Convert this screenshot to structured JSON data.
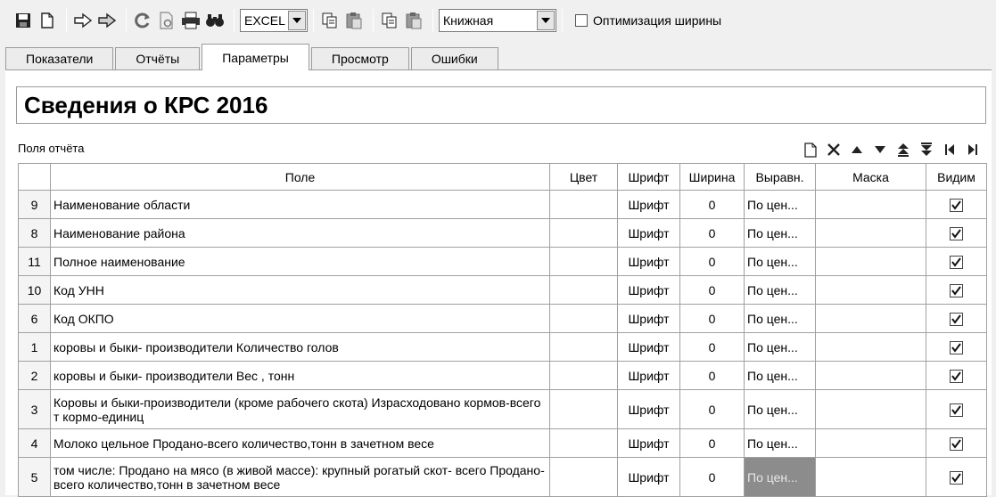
{
  "toolbar": {
    "export_format": "EXCEL",
    "orientation": "Книжная",
    "optimize_width_label": "Оптимизация ширины",
    "optimize_width_checked": false,
    "icons": [
      "save-icon",
      "new-document-icon",
      "export-icon",
      "import-icon",
      "refresh-icon",
      "preview-icon",
      "print-icon",
      "find-icon",
      "copy-icon",
      "paste-icon",
      "copy2-icon",
      "paste2-icon"
    ]
  },
  "tabs": [
    {
      "label": "Показатели",
      "active": false
    },
    {
      "label": "Отчёты",
      "active": false
    },
    {
      "label": "Параметры",
      "active": true
    },
    {
      "label": "Просмотр",
      "active": false
    },
    {
      "label": "Ошибки",
      "active": false
    }
  ],
  "report": {
    "title": "Сведения о КРС 2016",
    "fields_label": "Поля отчёта"
  },
  "grid": {
    "columns": [
      "Поле",
      "Цвет",
      "Шрифт",
      "Ширина",
      "Выравн.",
      "Маска",
      "Видим"
    ],
    "rows": [
      {
        "num": "9",
        "field": "Наименование области",
        "color": "",
        "font": "Шрифт",
        "width": "0",
        "align": "По цен...",
        "mask": "",
        "visible": true
      },
      {
        "num": "8",
        "field": "Наименование района",
        "color": "",
        "font": "Шрифт",
        "width": "0",
        "align": "По цен...",
        "mask": "",
        "visible": true
      },
      {
        "num": "11",
        "field": "Полное наименование",
        "color": "",
        "font": "Шрифт",
        "width": "0",
        "align": "По цен...",
        "mask": "",
        "visible": true
      },
      {
        "num": "10",
        "field": "Код УНН",
        "color": "",
        "font": "Шрифт",
        "width": "0",
        "align": "По цен...",
        "mask": "",
        "visible": true
      },
      {
        "num": "6",
        "field": "Код ОКПО",
        "color": "",
        "font": "Шрифт",
        "width": "0",
        "align": "По цен...",
        "mask": "",
        "visible": true
      },
      {
        "num": "1",
        "field": "коровы и быки- производители Количество голов",
        "color": "",
        "font": "Шрифт",
        "width": "0",
        "align": "По цен...",
        "mask": "",
        "visible": true
      },
      {
        "num": "2",
        "field": "коровы и быки- производители Вес , тонн",
        "color": "",
        "font": "Шрифт",
        "width": "0",
        "align": "По цен...",
        "mask": "",
        "visible": true
      },
      {
        "num": "3",
        "field": "Коровы и быки-производители (кроме рабочего скота) Израсходовано кормов-всего  т кормо-единиц",
        "color": "",
        "font": "Шрифт",
        "width": "0",
        "align": "По цен...",
        "mask": "",
        "visible": true
      },
      {
        "num": "4",
        "field": "Молоко цельное Продано-всего количество,тонн  в зачетном весе",
        "color": "",
        "font": "Шрифт",
        "width": "0",
        "align": "По цен...",
        "mask": "",
        "visible": true
      },
      {
        "num": "5",
        "field": "  том  числе: Продано на мясо (в живой массе):  крупный рогатый скот- всего Продано-всего количество,тонн  в зачетном весе",
        "color": "",
        "font": "Шрифт",
        "width": "0",
        "align": "По цен...",
        "mask": "",
        "visible": true
      }
    ]
  }
}
